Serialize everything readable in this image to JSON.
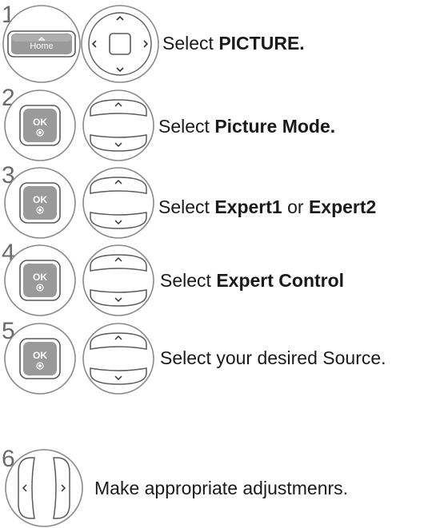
{
  "steps": [
    {
      "number": "1",
      "buttons": [
        "home-button",
        "navigation-pad"
      ],
      "text_pre": "Select ",
      "text_bold": "PICTURE.",
      "text_mid": "",
      "text_bold2": "",
      "text_post": ""
    },
    {
      "number": "2",
      "buttons": [
        "ok-button",
        "up-down-rocker"
      ],
      "text_pre": "Select ",
      "text_bold": "Picture Mode.",
      "text_mid": "",
      "text_bold2": "",
      "text_post": ""
    },
    {
      "number": "3",
      "buttons": [
        "ok-button",
        "up-down-rocker"
      ],
      "text_pre": "Select ",
      "text_bold": "Expert1",
      "text_mid": " or ",
      "text_bold2": "Expert2",
      "text_post": ""
    },
    {
      "number": "4",
      "buttons": [
        "ok-button",
        "up-down-rocker"
      ],
      "text_pre": "Select ",
      "text_bold": "Expert Control",
      "text_mid": "",
      "text_bold2": "",
      "text_post": ""
    },
    {
      "number": "5",
      "buttons": [
        "ok-button",
        "up-down-rocker"
      ],
      "text_pre": "Select your desired Source.",
      "text_bold": "",
      "text_mid": "",
      "text_bold2": "",
      "text_post": ""
    },
    {
      "number": "6",
      "buttons": [
        "left-right-rocker"
      ],
      "text_pre": "Make appropriate adjustmenrs.",
      "text_bold": "",
      "text_mid": "",
      "text_bold2": "",
      "text_post": ""
    }
  ],
  "labels": {
    "home": "Home",
    "ok": "OK"
  },
  "icons": {
    "up": "chevron-up-icon",
    "down": "chevron-down-icon",
    "left": "chevron-left-icon",
    "right": "chevron-right-icon"
  },
  "colors": {
    "ring": "#8a8a8a",
    "key_face": "#9a9a9a",
    "number": "#6a6a6a",
    "text": "#1a1a1a"
  }
}
